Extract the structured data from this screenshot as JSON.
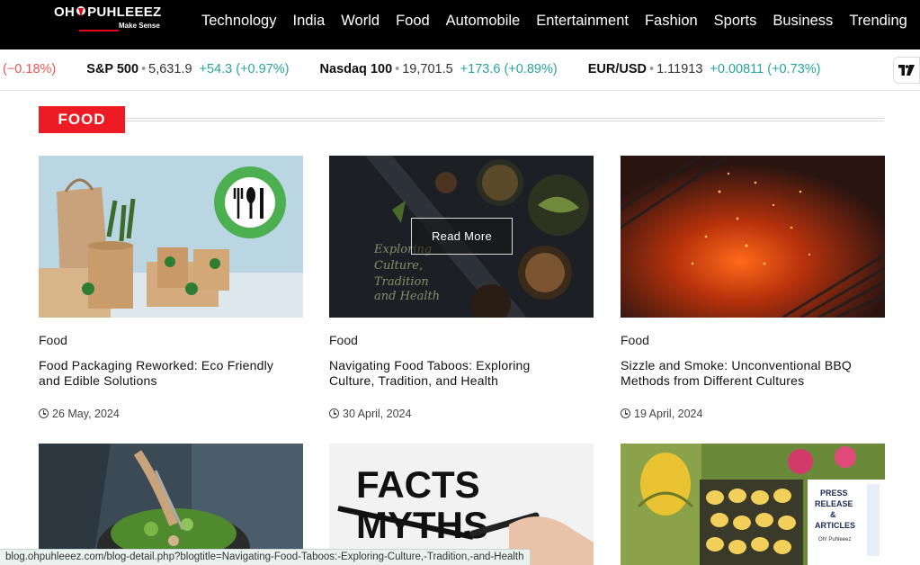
{
  "brand": {
    "logo_text_left": "OH",
    "logo_text_right": "PUHLEEEZ",
    "tagline": "Make Sense"
  },
  "nav": {
    "items": [
      "Technology",
      "India",
      "World",
      "Food",
      "Automobile",
      "Entertainment",
      "Fashion",
      "Sports",
      "Business",
      "Trending"
    ]
  },
  "ticker": {
    "lead_change": "(−0.18%)",
    "items": [
      {
        "name": "S&P 500",
        "price": "5,631.9",
        "change": "+54.3 (+0.97%)"
      },
      {
        "name": "Nasdaq 100",
        "price": "19,701.5",
        "change": "+173.6 (+0.89%)"
      },
      {
        "name": "EUR/USD",
        "price": "1.11913",
        "change": "+0.00811 (+0.73%)"
      }
    ],
    "widget_logo": "TV"
  },
  "section": {
    "label": "FOOD"
  },
  "cards": [
    {
      "category": "Food",
      "title": "Food Packaging Reworked: Eco Friendly and Edible Solutions",
      "date": "26 May, 2024",
      "image": "eco-packaging-image"
    },
    {
      "category": "Food",
      "title": "Navigating Food Taboos: Exploring Culture, Tradition, and Health",
      "date": "30 April, 2024",
      "image": "food-taboos-image",
      "overlay": "Read More",
      "image_text": "Explo ring Culture, Tradition and Health"
    },
    {
      "category": "Food",
      "title": "Sizzle and Smoke: Unconventional BBQ Methods from Different Cultures",
      "date": "19 April, 2024",
      "image": "bbq-grill-image"
    },
    {
      "image": "salad-bowl-image"
    },
    {
      "image": "facts-myths-image",
      "image_text_1": "FACTS",
      "image_text_2": "MYTHS"
    },
    {
      "image": "press-release-image",
      "badge_lines": [
        "PRESS",
        "RELEASE",
        "&",
        "ARTICLES"
      ],
      "badge_brand": "Oh! Puhleeez"
    }
  ],
  "statusbar": {
    "url": "blog.ohpuhleeez.com/blog-detail.php?blogtitle=Navigating-Food-Taboos:-Exploring-Culture,-Tradition,-and-Health"
  },
  "colors": {
    "accent": "#ed1c24",
    "nav_bg": "#000000",
    "ticker_up": "#26a69a",
    "ticker_down": "#ef5350"
  }
}
